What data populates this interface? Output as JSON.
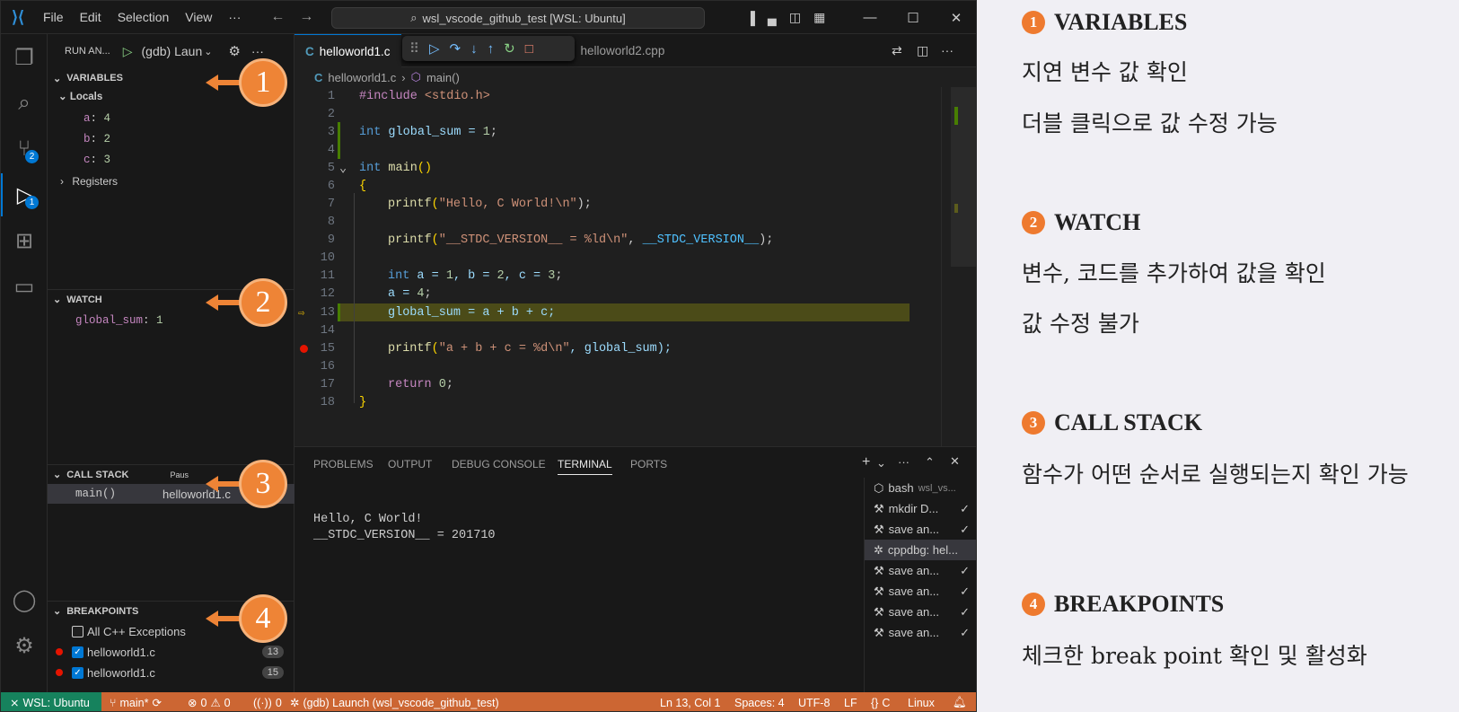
{
  "titlebar": {
    "menus": [
      "File",
      "Edit",
      "Selection",
      "View",
      "···"
    ],
    "search": "wsl_vscode_github_test [WSL: Ubuntu]"
  },
  "activity": {
    "scm_badge": "2",
    "debug_badge": "1"
  },
  "sidebar": {
    "run_header": "RUN AN...",
    "config": "(gdb) Laun",
    "variables": {
      "title": "VARIABLES",
      "locals_label": "Locals",
      "items": [
        {
          "name": "a",
          "value": "4"
        },
        {
          "name": "b",
          "value": "2"
        },
        {
          "name": "c",
          "value": "3"
        }
      ],
      "registers_label": "Registers"
    },
    "watch": {
      "title": "WATCH",
      "expr": "global_sum",
      "value": "1"
    },
    "call_stack": {
      "title": "CALL STACK",
      "state": "Paus",
      "frame": "main()",
      "file": "helloworld1.c"
    },
    "breakpoints": {
      "title": "BREAKPOINTS",
      "exceptions": "All C++ Exceptions",
      "items": [
        {
          "file": "helloworld1.c",
          "line": "13"
        },
        {
          "file": "helloworld1.c",
          "line": "15"
        }
      ]
    }
  },
  "editor": {
    "tabs": [
      "helloworld1.c",
      "helloworld2.cpp"
    ],
    "breadcrumb": {
      "file": "helloworld1.c",
      "symbol": "main()"
    },
    "lines": [
      {
        "n": "1"
      },
      {
        "n": "2"
      },
      {
        "n": "3"
      },
      {
        "n": "4"
      },
      {
        "n": "5"
      },
      {
        "n": "6"
      },
      {
        "n": "7"
      },
      {
        "n": "8"
      },
      {
        "n": "9"
      },
      {
        "n": "10"
      },
      {
        "n": "11"
      },
      {
        "n": "12"
      },
      {
        "n": "13"
      },
      {
        "n": "14"
      },
      {
        "n": "15"
      },
      {
        "n": "16"
      },
      {
        "n": "17"
      },
      {
        "n": "18"
      }
    ],
    "code": {
      "l1_inc": "#include",
      "l1_hdr": "<stdio.h>",
      "l3_type": "int",
      "l3_rest": " global_sum = ",
      "l3_num": "1",
      "l3_end": ";",
      "l5_type": "int",
      "l5_fn": "main",
      "l5_par": "()",
      "l6": "{",
      "l7_fn": "printf",
      "l7_str": "\"Hello, C World!\\n\"",
      "l7_end": ");",
      "l9_fn": "printf",
      "l9_str": "\"__STDC_VERSION__ = %ld\\n\"",
      "l9_mid": ", ",
      "l9_mac": "__STDC_VERSION__",
      "l9_end": ");",
      "l11_type": "int",
      "l11_rest": " a = ",
      "l11_n1": "1",
      "l11_b": ", b = ",
      "l11_n2": "2",
      "l11_c": ", c = ",
      "l11_n3": "3",
      "l11_end": ";",
      "l12_a": "a = ",
      "l12_n": "4",
      "l12_end": ";",
      "l13": "global_sum = a + b + c;",
      "l15_fn": "printf",
      "l15_str": "\"a + b + c = %d\\n\"",
      "l15_rest": ", global_sum);",
      "l17_kw": "return",
      "l17_n": "0",
      "l17_end": ";",
      "l18": "}"
    }
  },
  "panel": {
    "tabs": [
      "PROBLEMS",
      "OUTPUT",
      "DEBUG CONSOLE",
      "TERMINAL",
      "PORTS"
    ],
    "output": [
      "Hello, C World!",
      "__STDC_VERSION__ = 201710"
    ],
    "terminals": [
      {
        "name": "bash",
        "sub": "wsl_vs...",
        "check": false
      },
      {
        "name": "mkdir D...",
        "check": true
      },
      {
        "name": "save an...",
        "check": true
      },
      {
        "name": "cppdbg: hel...",
        "check": false
      },
      {
        "name": "save an...",
        "check": true
      },
      {
        "name": "save an...",
        "check": true
      },
      {
        "name": "save an...",
        "check": true
      },
      {
        "name": "save an...",
        "check": true
      }
    ]
  },
  "statusbar": {
    "remote": "WSL: Ubuntu",
    "branch": "main*",
    "errors": "0",
    "warnings": "0",
    "ports": "0",
    "launch": "(gdb) Launch (wsl_vscode_github_test)",
    "position": "Ln 13, Col 1",
    "spaces": "Spaces: 4",
    "encoding": "UTF-8",
    "eol": "LF",
    "language": "C",
    "platform": "Linux"
  },
  "callouts": [
    "1",
    "2",
    "3",
    "4"
  ],
  "notes": [
    {
      "num": "1",
      "title": "VARIABLES",
      "lines": [
        "지연 변수 값 확인",
        "더블 클릭으로 값 수정 가능"
      ]
    },
    {
      "num": "2",
      "title": "WATCH",
      "lines": [
        "변수, 코드를 추가하여 값을 확인",
        "값 수정 불가"
      ]
    },
    {
      "num": "3",
      "title": "CALL STACK",
      "lines": [
        "함수가 어떤 순서로 실행되는지 확인 가능"
      ]
    },
    {
      "num": "4",
      "title": "BREAKPOINTS",
      "lines": [
        "체크한 break point 확인 및 활성화"
      ]
    }
  ],
  "colors": {
    "accent": "#0078d4",
    "statusbar": "#cc6633",
    "callout": "#ee8436",
    "highlight": "#4b4b18"
  }
}
